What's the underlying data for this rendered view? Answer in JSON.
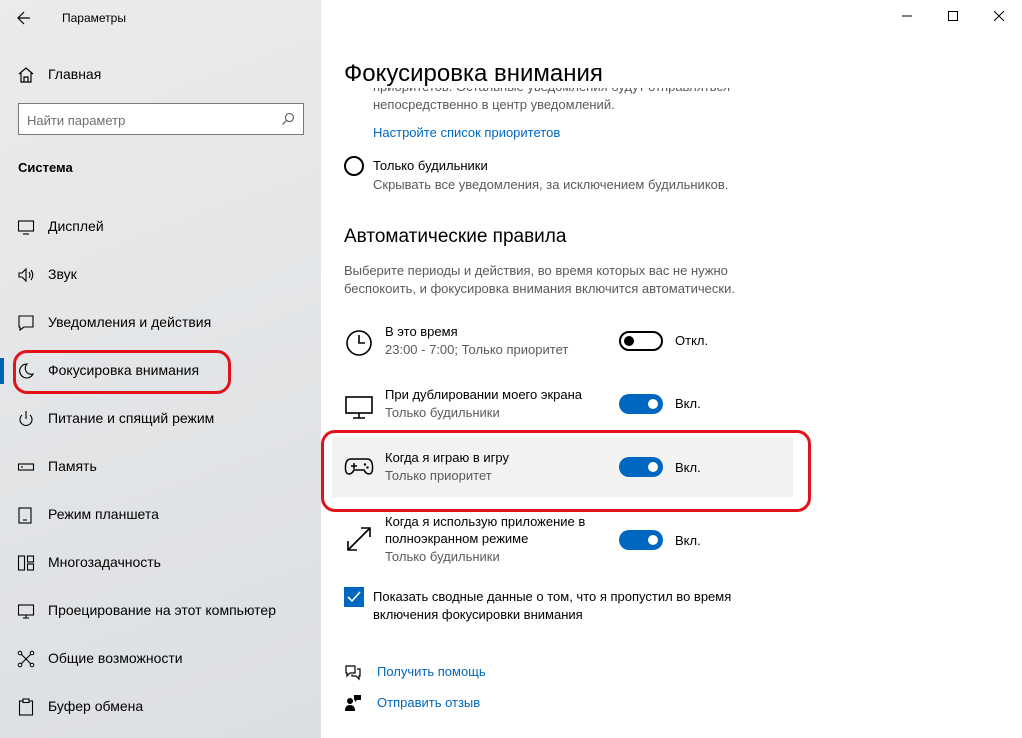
{
  "app": {
    "title": "Параметры",
    "window_controls": [
      "minimize",
      "maximize",
      "close"
    ]
  },
  "sidebar": {
    "home_label": "Главная",
    "search": {
      "placeholder": "Найти параметр",
      "value": ""
    },
    "section_title": "Система",
    "items": [
      {
        "label": "Дисплей",
        "icon": "display-icon"
      },
      {
        "label": "Звук",
        "icon": "speaker-icon"
      },
      {
        "label": "Уведомления и действия",
        "icon": "notification-icon"
      },
      {
        "label": "Фокусировка внимания",
        "icon": "moon-icon",
        "active": true
      },
      {
        "label": "Питание и спящий режим",
        "icon": "power-icon"
      },
      {
        "label": "Память",
        "icon": "storage-icon"
      },
      {
        "label": "Режим планшета",
        "icon": "tablet-icon"
      },
      {
        "label": "Многозадачность",
        "icon": "multitask-icon"
      },
      {
        "label": "Проецирование на этот компьютер",
        "icon": "projection-icon"
      },
      {
        "label": "Общие возможности",
        "icon": "shared-icon"
      },
      {
        "label": "Буфер обмена",
        "icon": "clipboard-icon"
      }
    ]
  },
  "main": {
    "title": "Фокусировка внимания",
    "cut_line1": "приоритетов. Остальные уведомления будут отправляться",
    "cut_line2": "непосредственно в центр уведомлений.",
    "priority_link": "Настройте список приоритетов",
    "alarms_only": {
      "label": "Только будильники",
      "description": "Скрывать все уведомления, за исключением будильников."
    },
    "auto_rules_heading": "Автоматические правила",
    "auto_rules_desc": "Выберите периоды и действия, во время которых вас не нужно беспокоить, и фокусировка внимания включится автоматически.",
    "rules": [
      {
        "title": "В это время",
        "subtitle": "23:00 - 7:00; Только приоритет",
        "state": "Откл.",
        "on": false,
        "icon": "clock-icon"
      },
      {
        "title": "При дублировании моего экрана",
        "subtitle": "Только будильники",
        "state": "Вкл.",
        "on": true,
        "icon": "monitor-icon"
      },
      {
        "title": "Когда я играю в игру",
        "subtitle": "Только приоритет",
        "state": "Вкл.",
        "on": true,
        "icon": "gamepad-icon"
      },
      {
        "title": "Когда я использую приложение в полноэкранном режиме",
        "title_line1": "Когда я использую приложение в",
        "title_line2": "полноэкранном режиме",
        "subtitle": "Только будильники",
        "state": "Вкл.",
        "on": true,
        "icon": "fullscreen-icon"
      }
    ],
    "summary_checkbox": {
      "label": "Показать сводные данные о том, что я пропустил во время включения фокусировки внимания",
      "checked": true
    },
    "help_link": "Получить помощь",
    "feedback_link": "Отправить отзыв"
  },
  "colors": {
    "accent": "#0067c0",
    "annotation": "#e0131b"
  }
}
